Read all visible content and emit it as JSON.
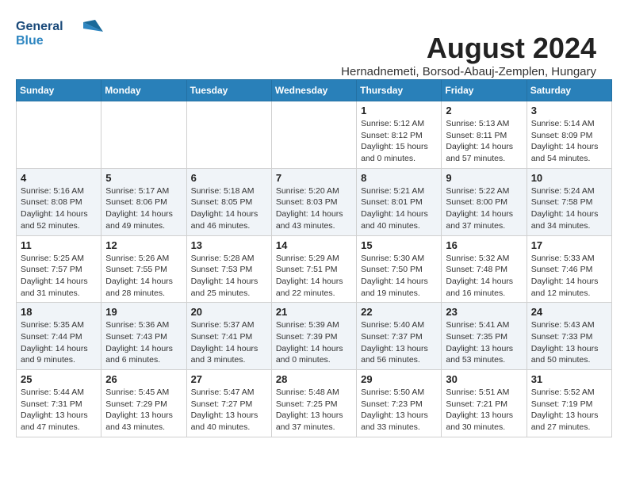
{
  "logo": {
    "line1": "General",
    "line2": "Blue"
  },
  "title": "August 2024",
  "subtitle": "Hernadnemeti, Borsod-Abauj-Zemplen, Hungary",
  "headers": [
    "Sunday",
    "Monday",
    "Tuesday",
    "Wednesday",
    "Thursday",
    "Friday",
    "Saturday"
  ],
  "weeks": [
    [
      {
        "day": "",
        "text": ""
      },
      {
        "day": "",
        "text": ""
      },
      {
        "day": "",
        "text": ""
      },
      {
        "day": "",
        "text": ""
      },
      {
        "day": "1",
        "text": "Sunrise: 5:12 AM\nSunset: 8:12 PM\nDaylight: 15 hours\nand 0 minutes."
      },
      {
        "day": "2",
        "text": "Sunrise: 5:13 AM\nSunset: 8:11 PM\nDaylight: 14 hours\nand 57 minutes."
      },
      {
        "day": "3",
        "text": "Sunrise: 5:14 AM\nSunset: 8:09 PM\nDaylight: 14 hours\nand 54 minutes."
      }
    ],
    [
      {
        "day": "4",
        "text": "Sunrise: 5:16 AM\nSunset: 8:08 PM\nDaylight: 14 hours\nand 52 minutes."
      },
      {
        "day": "5",
        "text": "Sunrise: 5:17 AM\nSunset: 8:06 PM\nDaylight: 14 hours\nand 49 minutes."
      },
      {
        "day": "6",
        "text": "Sunrise: 5:18 AM\nSunset: 8:05 PM\nDaylight: 14 hours\nand 46 minutes."
      },
      {
        "day": "7",
        "text": "Sunrise: 5:20 AM\nSunset: 8:03 PM\nDaylight: 14 hours\nand 43 minutes."
      },
      {
        "day": "8",
        "text": "Sunrise: 5:21 AM\nSunset: 8:01 PM\nDaylight: 14 hours\nand 40 minutes."
      },
      {
        "day": "9",
        "text": "Sunrise: 5:22 AM\nSunset: 8:00 PM\nDaylight: 14 hours\nand 37 minutes."
      },
      {
        "day": "10",
        "text": "Sunrise: 5:24 AM\nSunset: 7:58 PM\nDaylight: 14 hours\nand 34 minutes."
      }
    ],
    [
      {
        "day": "11",
        "text": "Sunrise: 5:25 AM\nSunset: 7:57 PM\nDaylight: 14 hours\nand 31 minutes."
      },
      {
        "day": "12",
        "text": "Sunrise: 5:26 AM\nSunset: 7:55 PM\nDaylight: 14 hours\nand 28 minutes."
      },
      {
        "day": "13",
        "text": "Sunrise: 5:28 AM\nSunset: 7:53 PM\nDaylight: 14 hours\nand 25 minutes."
      },
      {
        "day": "14",
        "text": "Sunrise: 5:29 AM\nSunset: 7:51 PM\nDaylight: 14 hours\nand 22 minutes."
      },
      {
        "day": "15",
        "text": "Sunrise: 5:30 AM\nSunset: 7:50 PM\nDaylight: 14 hours\nand 19 minutes."
      },
      {
        "day": "16",
        "text": "Sunrise: 5:32 AM\nSunset: 7:48 PM\nDaylight: 14 hours\nand 16 minutes."
      },
      {
        "day": "17",
        "text": "Sunrise: 5:33 AM\nSunset: 7:46 PM\nDaylight: 14 hours\nand 12 minutes."
      }
    ],
    [
      {
        "day": "18",
        "text": "Sunrise: 5:35 AM\nSunset: 7:44 PM\nDaylight: 14 hours\nand 9 minutes."
      },
      {
        "day": "19",
        "text": "Sunrise: 5:36 AM\nSunset: 7:43 PM\nDaylight: 14 hours\nand 6 minutes."
      },
      {
        "day": "20",
        "text": "Sunrise: 5:37 AM\nSunset: 7:41 PM\nDaylight: 14 hours\nand 3 minutes."
      },
      {
        "day": "21",
        "text": "Sunrise: 5:39 AM\nSunset: 7:39 PM\nDaylight: 14 hours\nand 0 minutes."
      },
      {
        "day": "22",
        "text": "Sunrise: 5:40 AM\nSunset: 7:37 PM\nDaylight: 13 hours\nand 56 minutes."
      },
      {
        "day": "23",
        "text": "Sunrise: 5:41 AM\nSunset: 7:35 PM\nDaylight: 13 hours\nand 53 minutes."
      },
      {
        "day": "24",
        "text": "Sunrise: 5:43 AM\nSunset: 7:33 PM\nDaylight: 13 hours\nand 50 minutes."
      }
    ],
    [
      {
        "day": "25",
        "text": "Sunrise: 5:44 AM\nSunset: 7:31 PM\nDaylight: 13 hours\nand 47 minutes."
      },
      {
        "day": "26",
        "text": "Sunrise: 5:45 AM\nSunset: 7:29 PM\nDaylight: 13 hours\nand 43 minutes."
      },
      {
        "day": "27",
        "text": "Sunrise: 5:47 AM\nSunset: 7:27 PM\nDaylight: 13 hours\nand 40 minutes."
      },
      {
        "day": "28",
        "text": "Sunrise: 5:48 AM\nSunset: 7:25 PM\nDaylight: 13 hours\nand 37 minutes."
      },
      {
        "day": "29",
        "text": "Sunrise: 5:50 AM\nSunset: 7:23 PM\nDaylight: 13 hours\nand 33 minutes."
      },
      {
        "day": "30",
        "text": "Sunrise: 5:51 AM\nSunset: 7:21 PM\nDaylight: 13 hours\nand 30 minutes."
      },
      {
        "day": "31",
        "text": "Sunrise: 5:52 AM\nSunset: 7:19 PM\nDaylight: 13 hours\nand 27 minutes."
      }
    ]
  ]
}
